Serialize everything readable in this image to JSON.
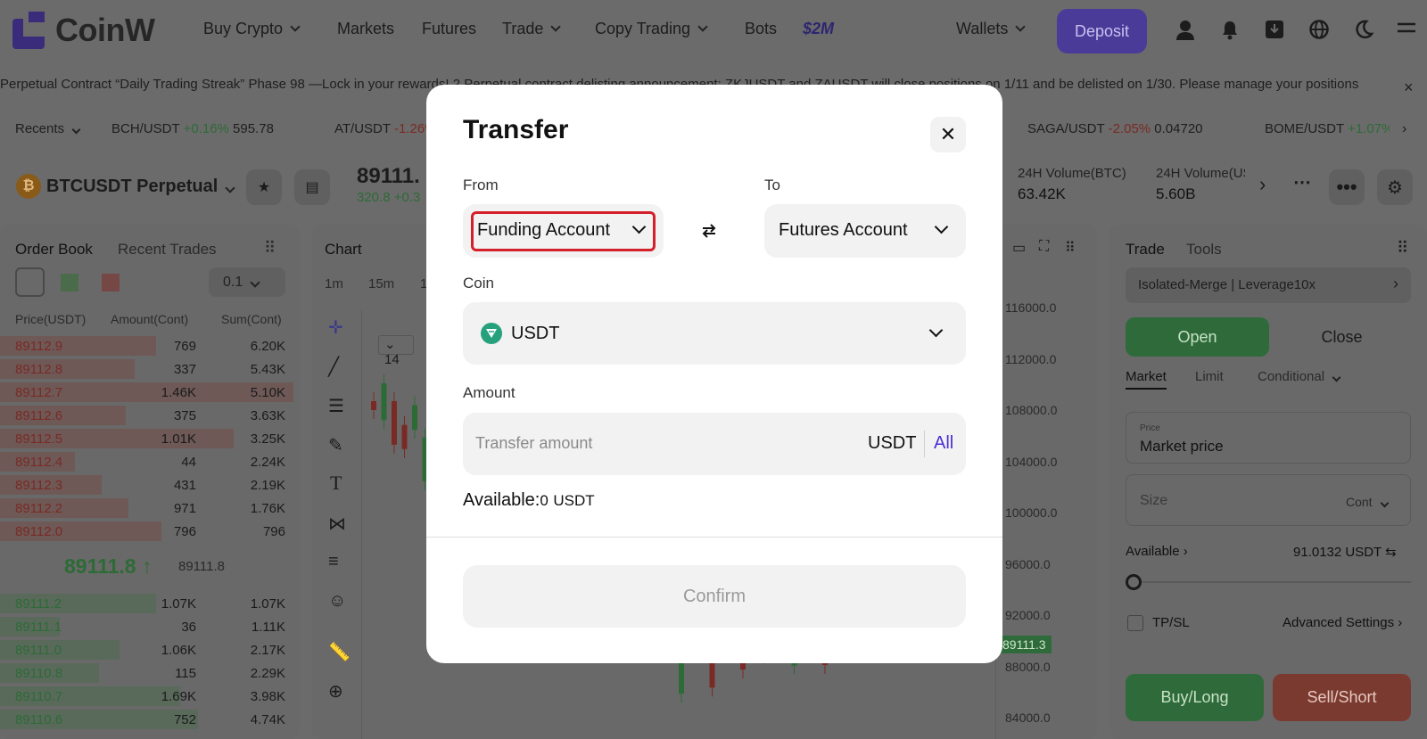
{
  "header": {
    "logo_text": "CoinW",
    "nav": [
      {
        "label": "Buy Crypto",
        "dropdown": true
      },
      {
        "label": "Markets",
        "dropdown": false
      },
      {
        "label": "Futures",
        "dropdown": false
      },
      {
        "label": "Trade",
        "dropdown": true
      },
      {
        "label": "Copy Trading",
        "dropdown": true
      },
      {
        "label": "Bots",
        "dropdown": false
      },
      {
        "label": "$2M",
        "dropdown": false
      }
    ],
    "wallets_label": "Wallets",
    "deposit_label": "Deposit",
    "icons": [
      "user-icon",
      "bell-icon",
      "download-icon",
      "globe-icon",
      "moon-icon",
      "menu-icon"
    ]
  },
  "announcement": {
    "text": "Perpetual Contract “Daily Trading Streak” Phase 98 —Lock in your rewards! 2 Perpetual contract delisting announcement: ZKJUSDT and ZAUSDT will close positions on 1/11 and be delisted on 1/30. Please manage your positions",
    "close": "×"
  },
  "ticker": {
    "recents_label": "Recents",
    "items": [
      {
        "pair": "BCH/USDT",
        "change": "+0.16%",
        "price": "595.78",
        "dir": "up"
      },
      {
        "pair": "AT/USDT",
        "change": "-1.26%",
        "price": "",
        "dir": "down"
      },
      {
        "pair": "SAGA/USDT",
        "change": "-2.05%",
        "price": "0.04720",
        "dir": "down"
      },
      {
        "pair": "BOME/USDT",
        "change": "+1.07%",
        "price": "",
        "dir": "up"
      }
    ]
  },
  "pair_bar": {
    "symbol": "BTCUSDT Perpetual",
    "last_price": "89111.",
    "change": "320.8 +0.3",
    "vol_btc_label": "24H Volume(BTC)",
    "vol_btc": "63.42K",
    "vol_usdt_label": "24H Volume(US",
    "vol_usdt": "5.60B"
  },
  "order_book": {
    "tab_active": "Order Book",
    "tab_other": "Recent Trades",
    "precision": "0.1",
    "headers": [
      "Price(USDT)",
      "Amount(Cont)",
      "Sum(Cont)"
    ],
    "asks": [
      {
        "price": "89112.9",
        "amount": "769",
        "sum": "6.20K",
        "depth": 0.52
      },
      {
        "price": "89112.8",
        "amount": "337",
        "sum": "5.43K",
        "depth": 0.45
      },
      {
        "price": "89112.7",
        "amount": "1.46K",
        "sum": "5.10K",
        "depth": 0.98
      },
      {
        "price": "89112.6",
        "amount": "375",
        "sum": "3.63K",
        "depth": 0.42
      },
      {
        "price": "89112.5",
        "amount": "1.01K",
        "sum": "3.25K",
        "depth": 0.78
      },
      {
        "price": "89112.4",
        "amount": "44",
        "sum": "2.24K",
        "depth": 0.25
      },
      {
        "price": "89112.3",
        "amount": "431",
        "sum": "2.19K",
        "depth": 0.34
      },
      {
        "price": "89112.2",
        "amount": "971",
        "sum": "1.76K",
        "depth": 0.43
      },
      {
        "price": "89112.0",
        "amount": "796",
        "sum": "796",
        "depth": 0.54
      }
    ],
    "mid_price": "89111.8",
    "mid_mark": "89111.8",
    "bids": [
      {
        "price": "89111.2",
        "amount": "1.07K",
        "sum": "1.07K",
        "depth": 0.52
      },
      {
        "price": "89111.1",
        "amount": "36",
        "sum": "1.11K",
        "depth": 0.2
      },
      {
        "price": "89111.0",
        "amount": "1.06K",
        "sum": "2.17K",
        "depth": 0.4
      },
      {
        "price": "89110.8",
        "amount": "115",
        "sum": "2.29K",
        "depth": 0.33
      },
      {
        "price": "89110.7",
        "amount": "1.69K",
        "sum": "3.98K",
        "depth": 0.6
      },
      {
        "price": "89110.6",
        "amount": "752",
        "sum": "4.74K",
        "depth": 0.66
      }
    ]
  },
  "chart": {
    "title": "Chart",
    "intervals": [
      "1m",
      "15m",
      "1"
    ],
    "price_axis": [
      "116000.0",
      "112000.0",
      "108000.0",
      "104000.0",
      "100000.0",
      "96000.0",
      "92000.0",
      "88000.0",
      "84000.0"
    ],
    "current_price_tag": "89111.3",
    "indicator_value": "14"
  },
  "trade_panel": {
    "tab_active": "Trade",
    "tab_other": "Tools",
    "margin_mode": "Isolated-Merge | Leverage10x",
    "open_label": "Open",
    "close_label": "Close",
    "order_types": [
      "Market",
      "Limit",
      "Conditional"
    ],
    "price_label": "Price",
    "price_value": "Market price",
    "size_placeholder": "Size",
    "size_unit": "Cont",
    "available_label": "Available",
    "available_value": "91.0132 USDT",
    "tpsl_label": "TP/SL",
    "advanced_label": "Advanced Settings",
    "buy_label": "Buy/Long",
    "sell_label": "Sell/Short"
  },
  "modal": {
    "title": "Transfer",
    "from_label": "From",
    "from_value": "Funding Account",
    "to_label": "To",
    "to_value": "Futures Account",
    "coin_label": "Coin",
    "coin_value": "USDT",
    "amount_label": "Amount",
    "amount_placeholder": "Transfer amount",
    "amount_unit": "USDT",
    "all_label": "All",
    "available_label": "Available:",
    "available_value": "0",
    "available_unit": "USDT",
    "confirm_label": "Confirm"
  }
}
